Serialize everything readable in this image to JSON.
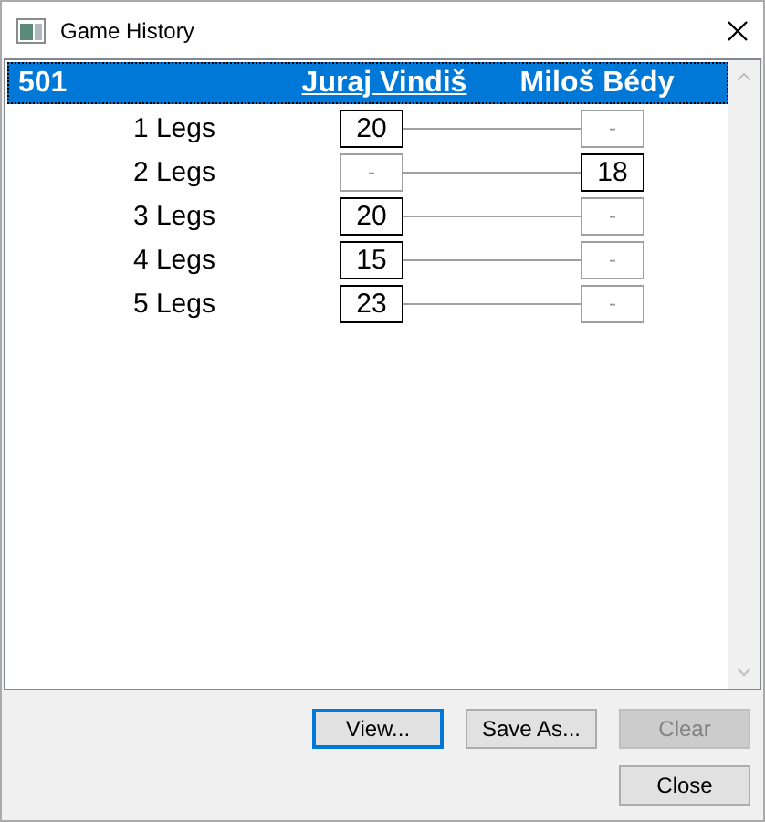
{
  "window": {
    "title": "Game History"
  },
  "match": {
    "game": "501",
    "selected": true,
    "players": [
      {
        "name": "Juraj Vindiš",
        "winner": true
      },
      {
        "name": "Miloš Bédy",
        "winner": false
      }
    ],
    "legs": [
      {
        "label": "1 Legs",
        "scores": [
          {
            "value": "20",
            "won": true
          },
          {
            "value": "-",
            "won": false
          }
        ]
      },
      {
        "label": "2 Legs",
        "scores": [
          {
            "value": "-",
            "won": false
          },
          {
            "value": "18",
            "won": true
          }
        ]
      },
      {
        "label": "3 Legs",
        "scores": [
          {
            "value": "20",
            "won": true
          },
          {
            "value": "-",
            "won": false
          }
        ]
      },
      {
        "label": "4 Legs",
        "scores": [
          {
            "value": "15",
            "won": true
          },
          {
            "value": "-",
            "won": false
          }
        ]
      },
      {
        "label": "5 Legs",
        "scores": [
          {
            "value": "23",
            "won": true
          },
          {
            "value": "-",
            "won": false
          }
        ]
      }
    ]
  },
  "buttons": [
    {
      "label": "View...",
      "default": true,
      "disabled": false
    },
    {
      "label": "Save As...",
      "default": false,
      "disabled": false
    },
    {
      "label": "Clear",
      "default": false,
      "disabled": true
    }
  ],
  "close_button": {
    "label": "Close",
    "default": false,
    "disabled": false
  }
}
